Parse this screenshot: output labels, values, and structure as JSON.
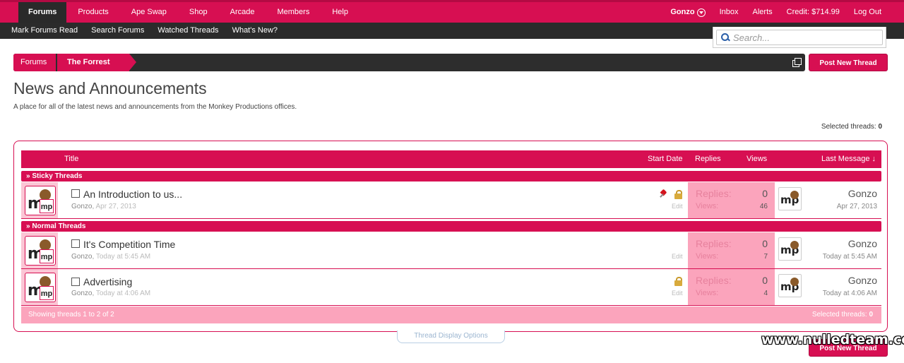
{
  "nav": {
    "tabs": [
      {
        "label": "Forums",
        "active": true
      },
      {
        "label": "Products"
      },
      {
        "label": "Ape Swap"
      },
      {
        "label": "Shop"
      },
      {
        "label": "Arcade"
      },
      {
        "label": "Members"
      },
      {
        "label": "Help"
      }
    ],
    "user": "Gonzo",
    "inbox": "Inbox",
    "alerts": "Alerts",
    "credit": "Credit: $714.99",
    "logout": "Log Out"
  },
  "subnav": {
    "links": [
      "Mark Forums Read",
      "Search Forums",
      "Watched Threads",
      "What's New?"
    ]
  },
  "search": {
    "placeholder": "Search..."
  },
  "breadcrumb": {
    "home": "Forums",
    "current": "The Forrest"
  },
  "post_button": "Post New Thread",
  "page": {
    "title": "News and Announcements",
    "description": "A place for all of the latest news and announcements from the Monkey Productions offices.",
    "selected_label": "Selected threads:",
    "selected_count": "0"
  },
  "table": {
    "headers": {
      "title": "Title",
      "start_date": "Start Date",
      "replies": "Replies",
      "views": "Views",
      "last_message": "Last Message ↓"
    },
    "sections": {
      "sticky": "» Sticky Threads",
      "normal": "» Normal Threads"
    },
    "replies_label": "Replies:",
    "views_label": "Views:",
    "edit_label": "Edit",
    "avatar_letter": "m",
    "avatar_small": "mp",
    "threads": [
      {
        "title": "An Introduction to us...",
        "author": "Gonzo",
        "date": "Apr 27, 2013",
        "replies": "0",
        "views": "46",
        "last_user": "Gonzo",
        "last_date": "Apr 27, 2013",
        "sticky": true,
        "locked": true
      },
      {
        "title": "It's Competition Time",
        "author": "Gonzo",
        "date": "Today at 5:45 AM",
        "replies": "0",
        "views": "7",
        "last_user": "Gonzo",
        "last_date": "Today at 5:45 AM",
        "sticky": false,
        "locked": false
      },
      {
        "title": "Advertising",
        "author": "Gonzo",
        "date": "Today at 4:06 AM",
        "replies": "0",
        "views": "4",
        "last_user": "Gonzo",
        "last_date": "Today at 4:06 AM",
        "sticky": false,
        "locked": true
      }
    ],
    "footer_left": "Showing threads 1 to 2 of 2",
    "footer_right_label": "Selected threads:",
    "footer_right_count": "0"
  },
  "display_options": "Thread Display Options",
  "watermark": "www.nulledteam.com",
  "colors": {
    "accent": "#d70f52",
    "dark": "#2b2b2b",
    "stats_bg": "#fba4bc"
  }
}
